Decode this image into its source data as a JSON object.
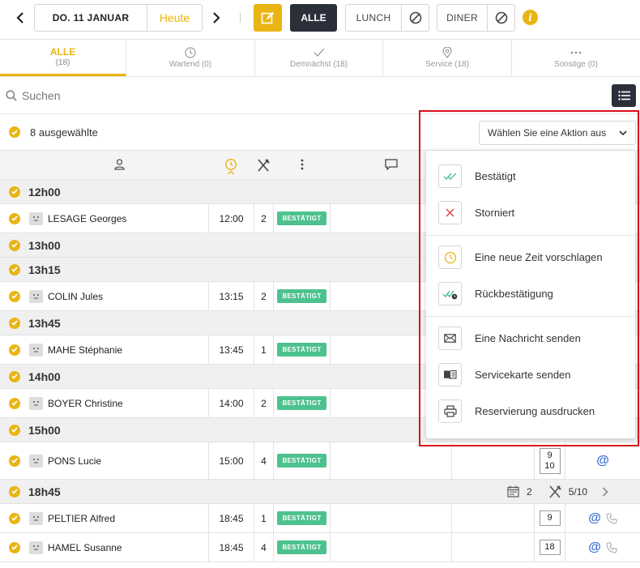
{
  "topbar": {
    "date_label": "DO. 11 JANUAR",
    "today_label": "Heute",
    "all_label": "ALLE",
    "lunch_label": "LUNCH",
    "diner_label": "DINER",
    "info_label": "i"
  },
  "tabs": [
    {
      "label": "ALLE",
      "count": "(18)",
      "icon": "none"
    },
    {
      "label": "Wartend (0)",
      "icon": "clock-icon"
    },
    {
      "label": "Demnächst (18)",
      "icon": "check-icon"
    },
    {
      "label": "Service (18)",
      "icon": "pin-icon"
    },
    {
      "label": "Sonstige (0)",
      "icon": "more-icon"
    }
  ],
  "search": {
    "placeholder": "Suchen"
  },
  "selection": {
    "label": "8 ausgewählte",
    "action_placeholder": "Wählen Sie eine Aktion aus"
  },
  "groups": [
    {
      "time": "12h00",
      "rows": [
        {
          "name": "LESAGE Georges",
          "time": "12:00",
          "covers": "2",
          "status": "BESTÄTIGT"
        }
      ]
    },
    {
      "time": "13h00",
      "rows": []
    },
    {
      "time": "13h15",
      "rows": [
        {
          "name": "COLIN Jules",
          "time": "13:15",
          "covers": "2",
          "status": "BESTÄTIGT"
        }
      ]
    },
    {
      "time": "13h45",
      "rows": [
        {
          "name": "MAHE Stéphanie",
          "time": "13:45",
          "covers": "1",
          "status": "BESTÄTIGT"
        }
      ]
    },
    {
      "time": "14h00",
      "rows": [
        {
          "name": "BOYER Christine",
          "time": "14:00",
          "covers": "2",
          "status": "BESTÄTIGT"
        }
      ]
    },
    {
      "time": "15h00",
      "rows": [
        {
          "name": "PONS Lucie",
          "time": "15:00",
          "covers": "4",
          "status": "BESTÄTIGT",
          "table1": "9",
          "table2": "10",
          "email": "@"
        }
      ]
    },
    {
      "time": "18h45",
      "stats": {
        "bookings": "2",
        "covers": "5/10"
      },
      "rows": [
        {
          "name": "PELTIER Alfred",
          "time": "18:45",
          "covers": "1",
          "status": "BESTÄTIGT",
          "table1": "9",
          "email": "@"
        },
        {
          "name": "HAMEL Susanne",
          "time": "18:45",
          "covers": "4",
          "status": "BESTÄTIGT",
          "table1": "18",
          "email": "@"
        }
      ]
    }
  ],
  "action_menu": [
    {
      "label": "Bestätigt",
      "icon": "double-check-icon"
    },
    {
      "label": "Storniert",
      "icon": "cross-icon"
    },
    {
      "label": "Eine neue Zeit vorschlagen",
      "icon": "clock-icon"
    },
    {
      "label": "Rückbestätigung",
      "icon": "reconfirm-icon"
    },
    {
      "label": "Eine Nachricht senden",
      "icon": "envelope-icon"
    },
    {
      "label": "Servicekarte senden",
      "icon": "book-icon"
    },
    {
      "label": "Reservierung ausdrucken",
      "icon": "printer-icon"
    }
  ],
  "colors": {
    "accent": "#e9b513",
    "dark": "#2a2f3a",
    "confirmed": "#4dc28e",
    "highlight": "#d8101c",
    "link": "#3a6fd1"
  }
}
